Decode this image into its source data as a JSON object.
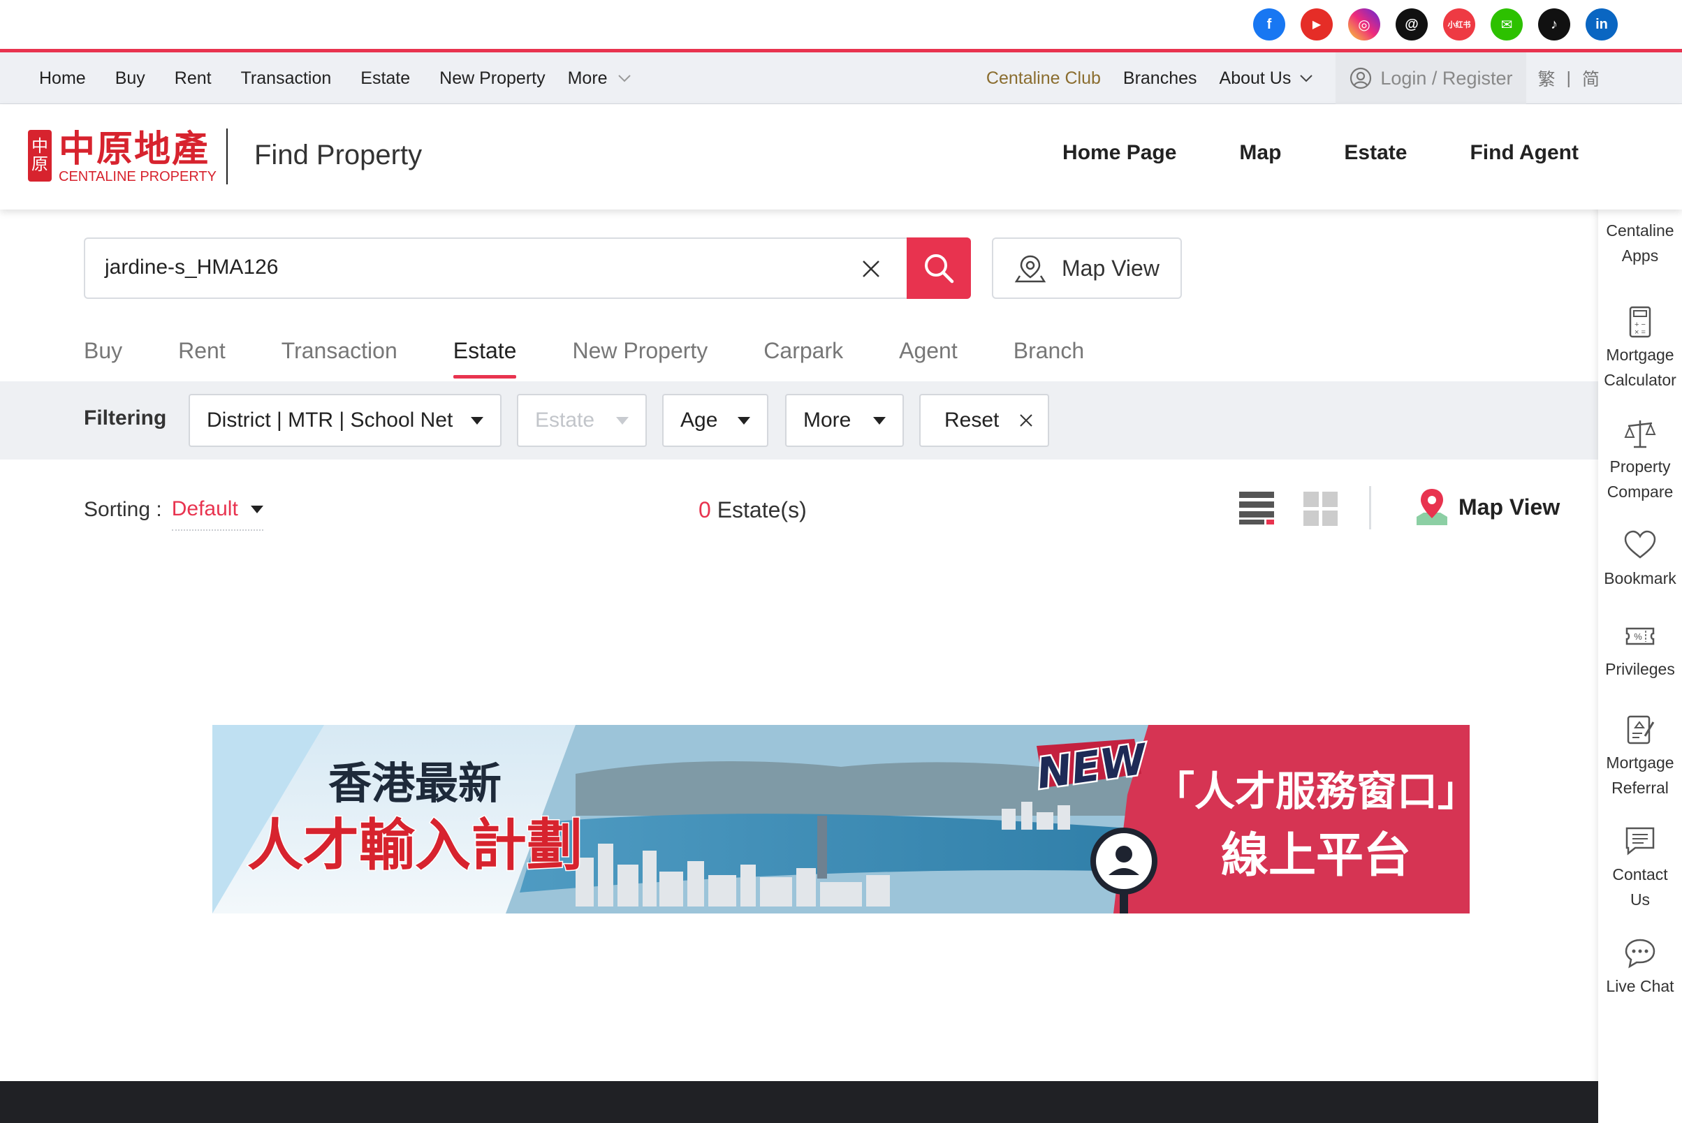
{
  "social": {
    "icons": [
      {
        "name": "facebook-icon",
        "glyph": "f",
        "color": "#1877f2"
      },
      {
        "name": "youtube-icon",
        "glyph": "▶",
        "color": "#e52d27"
      },
      {
        "name": "instagram-icon",
        "glyph": "◎",
        "color": "#d6249f"
      },
      {
        "name": "threads-icon",
        "glyph": "@",
        "color": "#111111"
      },
      {
        "name": "xiaohongshu-icon",
        "glyph": "小红书",
        "color": "#ee3a43"
      },
      {
        "name": "wechat-icon",
        "glyph": "✉",
        "color": "#2dc100"
      },
      {
        "name": "tiktok-icon",
        "glyph": "♪",
        "color": "#111111"
      },
      {
        "name": "linkedin-icon",
        "glyph": "in",
        "color": "#0a66c2"
      }
    ]
  },
  "topnav": {
    "left": [
      "Home",
      "Buy",
      "Rent",
      "Transaction",
      "Estate",
      "New Property"
    ],
    "more": "More",
    "club": "Centaline Club",
    "branches": "Branches",
    "about": "About Us",
    "login": "Login / Register",
    "lang_trad": "繁",
    "lang_sep": "|",
    "lang_simp": "简"
  },
  "header": {
    "logo_cn": "中原地產",
    "logo_en": "CENTALINE PROPERTY",
    "logo_seal_top": "中",
    "logo_seal_bottom": "原",
    "title": "Find Property",
    "nav": [
      "Home Page",
      "Map",
      "Estate",
      "Find Agent"
    ]
  },
  "search": {
    "value": "jardine-s_HMA126",
    "map_view": "Map View"
  },
  "tabs": {
    "items": [
      "Buy",
      "Rent",
      "Transaction",
      "Estate",
      "New Property",
      "Carpark",
      "Agent",
      "Branch"
    ],
    "active": "Estate"
  },
  "filter": {
    "label": "Filtering",
    "district": "District | MTR | School Net",
    "estate": "Estate",
    "age": "Age",
    "more": "More",
    "reset": "Reset"
  },
  "results": {
    "sorting_label": "Sorting :",
    "sorting_value": "Default",
    "count": "0",
    "count_label": "Estate(s)",
    "map_view": "Map View"
  },
  "banner": {
    "line1": "香港最新",
    "line2": "人才輸入計劃",
    "new_badge": "NEW",
    "right_line1": "「人才服務窗口」",
    "right_line2": "線上平台"
  },
  "sidebar": {
    "items": [
      {
        "icon": "phone-icon",
        "label1": "Centaline",
        "label2": "Apps"
      },
      {
        "icon": "calculator-icon",
        "label1": "Mortgage",
        "label2": "Calculator"
      },
      {
        "icon": "scale-icon",
        "label1": "Property",
        "label2": "Compare"
      },
      {
        "icon": "heart-icon",
        "label1": "Bookmark",
        "label2": ""
      },
      {
        "icon": "coupon-icon",
        "label1": "Privileges",
        "label2": ""
      },
      {
        "icon": "form-icon",
        "label1": "Mortgage",
        "label2": "Referral"
      },
      {
        "icon": "message-icon",
        "label1": "Contact",
        "label2": "Us"
      },
      {
        "icon": "chat-icon",
        "label1": "Live Chat",
        "label2": ""
      }
    ]
  },
  "colors": {
    "accent": "#e8334f",
    "brand": "#d7232e",
    "club": "#8a6d2f",
    "footer": "#202125"
  }
}
